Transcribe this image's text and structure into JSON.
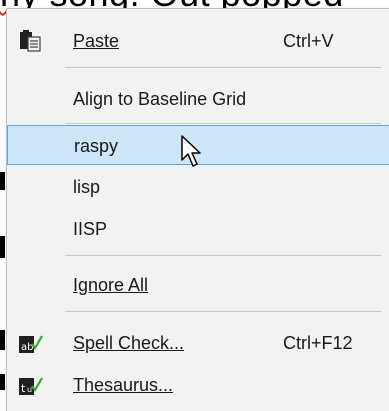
{
  "document": {
    "visible_text_fragment": "ny song. Out popped"
  },
  "context_menu": {
    "paste": {
      "label": "Paste",
      "shortcut": "Ctrl+V",
      "icon": "clipboard-paste-icon"
    },
    "align_baseline": {
      "label": "Align to Baseline Grid"
    },
    "suggestions": [
      "raspy",
      "lisp",
      "IISP"
    ],
    "highlighted_suggestion": "raspy",
    "ignore_all": {
      "label": "Ignore All"
    },
    "spell_check": {
      "label": "Spell Check...",
      "shortcut": "Ctrl+F12",
      "icon": "spell-check-icon"
    },
    "thesaurus": {
      "label": "Thesaurus...",
      "icon": "thesaurus-icon"
    }
  },
  "colors": {
    "menu_bg": "#f2f2f2",
    "highlight_bg": "#cde6f7",
    "highlight_border": "#5fa6dc",
    "separator": "#c8c8c8",
    "spell_underline": "#d12a2a",
    "check_green": "#3aa53a"
  }
}
